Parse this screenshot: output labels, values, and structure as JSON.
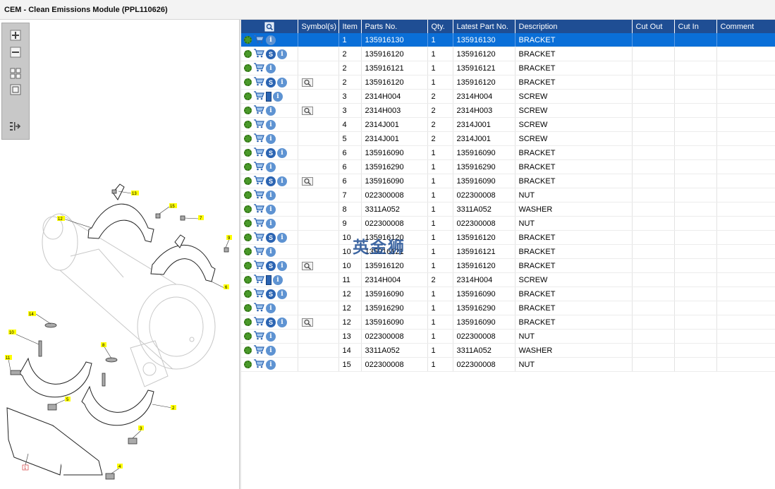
{
  "window": {
    "title": "CEM - Clean Emissions Module (PPL110626)"
  },
  "toolbar": {
    "buttons": [
      "zoom-in",
      "zoom-out",
      "fit-page",
      "actual-size",
      "export"
    ]
  },
  "diagram": {
    "callouts": [
      "1",
      "2",
      "3",
      "4",
      "5",
      "6",
      "7",
      "8",
      "9",
      "10",
      "11",
      "12",
      "13",
      "14",
      "15"
    ]
  },
  "grid": {
    "columns": [
      "",
      "Symbol(s)",
      "Item",
      "Parts No.",
      "Qty.",
      "Latest Part No.",
      "Description",
      "Cut Out",
      "Cut In",
      "Comment"
    ],
    "rows": [
      {
        "icons": [
          "gear",
          "cart",
          "info"
        ],
        "symbol": "",
        "item": "1",
        "parts_no": "135916130",
        "qty": "1",
        "latest": "135916130",
        "desc": "BRACKET",
        "selected": true
      },
      {
        "icons": [
          "gear",
          "cart",
          "s",
          "info"
        ],
        "symbol": "",
        "item": "2",
        "parts_no": "135916120",
        "qty": "1",
        "latest": "135916120",
        "desc": "BRACKET",
        "selected": false
      },
      {
        "icons": [
          "gear",
          "cart",
          "info"
        ],
        "symbol": "",
        "item": "2",
        "parts_no": "135916121",
        "qty": "1",
        "latest": "135916121",
        "desc": "BRACKET",
        "selected": false
      },
      {
        "icons": [
          "gear",
          "cart",
          "s",
          "info"
        ],
        "symbol": "lens",
        "item": "2",
        "parts_no": "135916120",
        "qty": "1",
        "latest": "135916120",
        "desc": "BRACKET",
        "selected": false
      },
      {
        "icons": [
          "gear",
          "cart",
          "book",
          "info"
        ],
        "symbol": "",
        "item": "3",
        "parts_no": "2314H004",
        "qty": "2",
        "latest": "2314H004",
        "desc": "SCREW",
        "selected": false
      },
      {
        "icons": [
          "gear",
          "cart",
          "info"
        ],
        "symbol": "lens",
        "item": "3",
        "parts_no": "2314H003",
        "qty": "2",
        "latest": "2314H003",
        "desc": "SCREW",
        "selected": false
      },
      {
        "icons": [
          "gear",
          "cart",
          "info"
        ],
        "symbol": "",
        "item": "4",
        "parts_no": "2314J001",
        "qty": "2",
        "latest": "2314J001",
        "desc": "SCREW",
        "selected": false
      },
      {
        "icons": [
          "gear",
          "cart",
          "info"
        ],
        "symbol": "",
        "item": "5",
        "parts_no": "2314J001",
        "qty": "2",
        "latest": "2314J001",
        "desc": "SCREW",
        "selected": false
      },
      {
        "icons": [
          "gear",
          "cart",
          "s",
          "info"
        ],
        "symbol": "",
        "item": "6",
        "parts_no": "135916090",
        "qty": "1",
        "latest": "135916090",
        "desc": "BRACKET",
        "selected": false
      },
      {
        "icons": [
          "gear",
          "cart",
          "info"
        ],
        "symbol": "",
        "item": "6",
        "parts_no": "135916290",
        "qty": "1",
        "latest": "135916290",
        "desc": "BRACKET",
        "selected": false
      },
      {
        "icons": [
          "gear",
          "cart",
          "s",
          "info"
        ],
        "symbol": "lens",
        "item": "6",
        "parts_no": "135916090",
        "qty": "1",
        "latest": "135916090",
        "desc": "BRACKET",
        "selected": false
      },
      {
        "icons": [
          "gear",
          "cart",
          "info"
        ],
        "symbol": "",
        "item": "7",
        "parts_no": "022300008",
        "qty": "1",
        "latest": "022300008",
        "desc": "NUT",
        "selected": false
      },
      {
        "icons": [
          "gear",
          "cart",
          "info"
        ],
        "symbol": "",
        "item": "8",
        "parts_no": "3311A052",
        "qty": "1",
        "latest": "3311A052",
        "desc": "WASHER",
        "selected": false
      },
      {
        "icons": [
          "gear",
          "cart",
          "info"
        ],
        "symbol": "",
        "item": "9",
        "parts_no": "022300008",
        "qty": "1",
        "latest": "022300008",
        "desc": "NUT",
        "selected": false
      },
      {
        "icons": [
          "gear",
          "cart",
          "s",
          "info"
        ],
        "symbol": "",
        "item": "10",
        "parts_no": "135916120",
        "qty": "1",
        "latest": "135916120",
        "desc": "BRACKET",
        "selected": false
      },
      {
        "icons": [
          "gear",
          "cart",
          "info"
        ],
        "symbol": "",
        "item": "10",
        "parts_no": "135916121",
        "qty": "1",
        "latest": "135916121",
        "desc": "BRACKET",
        "selected": false
      },
      {
        "icons": [
          "gear",
          "cart",
          "s",
          "info"
        ],
        "symbol": "lens",
        "item": "10",
        "parts_no": "135916120",
        "qty": "1",
        "latest": "135916120",
        "desc": "BRACKET",
        "selected": false
      },
      {
        "icons": [
          "gear",
          "cart",
          "book",
          "info"
        ],
        "symbol": "",
        "item": "11",
        "parts_no": "2314H004",
        "qty": "2",
        "latest": "2314H004",
        "desc": "SCREW",
        "selected": false
      },
      {
        "icons": [
          "gear",
          "cart",
          "s",
          "info"
        ],
        "symbol": "",
        "item": "12",
        "parts_no": "135916090",
        "qty": "1",
        "latest": "135916090",
        "desc": "BRACKET",
        "selected": false
      },
      {
        "icons": [
          "gear",
          "cart",
          "info"
        ],
        "symbol": "",
        "item": "12",
        "parts_no": "135916290",
        "qty": "1",
        "latest": "135916290",
        "desc": "BRACKET",
        "selected": false
      },
      {
        "icons": [
          "gear",
          "cart",
          "s",
          "info"
        ],
        "symbol": "lens",
        "item": "12",
        "parts_no": "135916090",
        "qty": "1",
        "latest": "135916090",
        "desc": "BRACKET",
        "selected": false
      },
      {
        "icons": [
          "gear",
          "cart",
          "info"
        ],
        "symbol": "",
        "item": "13",
        "parts_no": "022300008",
        "qty": "1",
        "latest": "022300008",
        "desc": "NUT",
        "selected": false
      },
      {
        "icons": [
          "gear",
          "cart",
          "info"
        ],
        "symbol": "",
        "item": "14",
        "parts_no": "3311A052",
        "qty": "1",
        "latest": "3311A052",
        "desc": "WASHER",
        "selected": false
      },
      {
        "icons": [
          "gear",
          "cart",
          "info"
        ],
        "symbol": "",
        "item": "15",
        "parts_no": "022300008",
        "qty": "1",
        "latest": "022300008",
        "desc": "NUT",
        "selected": false
      }
    ]
  },
  "watermark": {
    "text": "英金狮"
  }
}
